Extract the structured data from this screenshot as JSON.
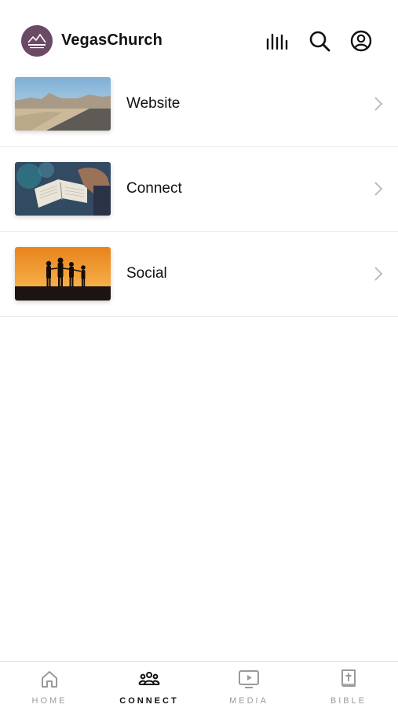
{
  "header": {
    "title": "VegasChurch",
    "logo_icon": "church-logo",
    "icons": [
      "audio-bars-icon",
      "search-icon",
      "account-icon"
    ]
  },
  "list": {
    "items": [
      {
        "label": "Website",
        "thumb": "desert-road"
      },
      {
        "label": "Connect",
        "thumb": "open-bible"
      },
      {
        "label": "Social",
        "thumb": "sunset-silhouettes"
      }
    ]
  },
  "tabbar": {
    "tabs": [
      {
        "label": "HOME",
        "icon": "home-icon",
        "active": false
      },
      {
        "label": "CONNECT",
        "icon": "people-icon",
        "active": true
      },
      {
        "label": "MEDIA",
        "icon": "tv-play-icon",
        "active": false
      },
      {
        "label": "BIBLE",
        "icon": "book-cross-icon",
        "active": false
      }
    ]
  },
  "colors": {
    "logo_bg": "#6b4a66",
    "active_tab": "#111111",
    "inactive_tab": "#9a9a9a",
    "divider": "#ececec"
  }
}
